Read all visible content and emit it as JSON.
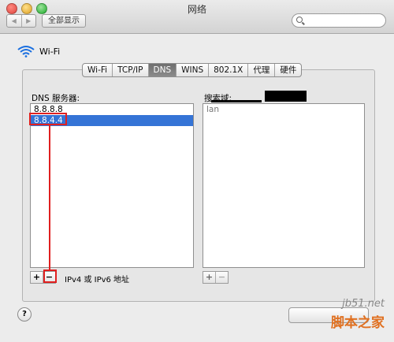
{
  "window": {
    "title": "网络"
  },
  "toolbar": {
    "back_glyph": "◀",
    "forward_glyph": "▶",
    "show_all_label": "全部显示",
    "search_placeholder": ""
  },
  "service": {
    "name": "Wi-Fi",
    "icon": "wifi-icon"
  },
  "tabs": [
    {
      "label": "Wi-Fi",
      "active": false
    },
    {
      "label": "TCP/IP",
      "active": false
    },
    {
      "label": "DNS",
      "active": true
    },
    {
      "label": "WINS",
      "active": false
    },
    {
      "label": "802.1X",
      "active": false
    },
    {
      "label": "代理",
      "active": false
    },
    {
      "label": "硬件",
      "active": false
    }
  ],
  "dns": {
    "label": "DNS 服务器:",
    "servers": [
      "8.8.8.8",
      "8.8.4.4"
    ],
    "selected_index": 1,
    "add_label": "+",
    "remove_label": "−",
    "hint": "IPv4 或 IPv6 地址"
  },
  "search_domains": {
    "label": "搜索域:",
    "domains": [
      "lan"
    ],
    "add_label": "+",
    "remove_label": "−"
  },
  "help": {
    "label": "?"
  },
  "watermark": {
    "domain": "jb51.net",
    "text": "脚本之家"
  },
  "colors": {
    "selection": "#3574d6",
    "annotation": "#e02020",
    "watermark": "#e07020"
  }
}
